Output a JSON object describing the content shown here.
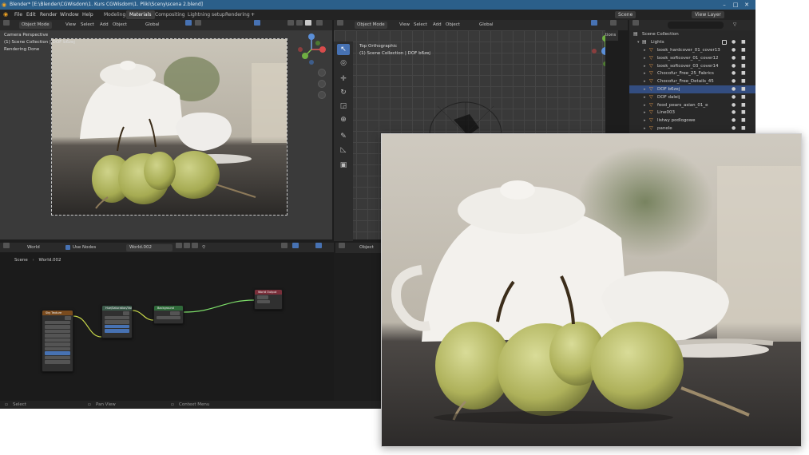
{
  "window": {
    "title": "Blender* [E:\\Blender\\CGWisdom\\1. Kurs CGWisdom\\1. Pliki\\Sceny\\scena 2.blend]"
  },
  "menubar": {
    "items": [
      "File",
      "Edit",
      "Render",
      "Window",
      "Help"
    ],
    "workspaces": [
      "Modeling",
      "Materials",
      "Compositing",
      "Lightning setup",
      "Rendering"
    ],
    "active_workspace": "Materials",
    "scene_label": "Scene",
    "view_layer_label": "View Layer"
  },
  "viewport_camera": {
    "mode": "Object Mode",
    "menus": [
      "View",
      "Select",
      "Add",
      "Object"
    ],
    "transform_orientation": "Global",
    "overlay_lines": [
      "Camera Perspective",
      "(1) Scene Collection | DOF b6zej",
      "Rendering Done"
    ]
  },
  "viewport_top": {
    "mode": "Object Mode",
    "menus": [
      "View",
      "Select",
      "Add",
      "Object"
    ],
    "transform_orientation": "Global",
    "options_label": "Options",
    "overlay_lines": [
      "Top Orthographic",
      "(1) Scene Collection | DOF b6zej"
    ]
  },
  "outliner": {
    "root": "Scene Collection",
    "collection": "Lights",
    "items": [
      {
        "label": "book_hardcover_01_cover13",
        "selected": false
      },
      {
        "label": "book_softcover_01_cover12",
        "selected": false
      },
      {
        "label": "book_softcover_03_cover14",
        "selected": false
      },
      {
        "label": "Chocofur_Free_25_Fabrics",
        "selected": false
      },
      {
        "label": "Chocofur_Free_Details_45",
        "selected": false
      },
      {
        "label": "DOF b6zej",
        "selected": true
      },
      {
        "label": "DOF daleij",
        "selected": false
      },
      {
        "label": "food_pears_asian_01_e",
        "selected": false
      },
      {
        "label": "Line003",
        "selected": false
      },
      {
        "label": "listwy podlogowe",
        "selected": false
      },
      {
        "label": "panele",
        "selected": false
      }
    ]
  },
  "node_editor": {
    "type_label": "World",
    "use_nodes_label": "Use Nodes",
    "world_name": "World.002",
    "breadcrumb": [
      "Scene",
      "World.002"
    ],
    "object_label": "Object",
    "nodes": [
      {
        "title": "Sky Texture",
        "color": "#7a4b1e"
      },
      {
        "title": "Hue/Saturation/Value",
        "color": "#3b5a4a"
      },
      {
        "title": "Background",
        "color": "#2f6a3a"
      },
      {
        "title": "World Output",
        "color": "#7a2f3a"
      }
    ]
  },
  "statusbar": {
    "items": [
      "Select",
      "Pan View",
      "Context Menu"
    ]
  },
  "colors": {
    "accent": "#4772b3",
    "titlebar": "#2b5f8a",
    "node_link": "#c8d84a"
  },
  "icons": [
    "blender-logo-icon",
    "minimize-icon",
    "maximize-icon",
    "close-icon",
    "mouse-icon",
    "eye-icon",
    "camera-icon",
    "filter-icon",
    "cursor-icon",
    "move-icon",
    "rotate-icon",
    "scale-icon",
    "transform-icon",
    "annotate-icon",
    "measure-icon",
    "add-cube-icon",
    "zoom-icon",
    "hand-icon",
    "grid-icon"
  ]
}
